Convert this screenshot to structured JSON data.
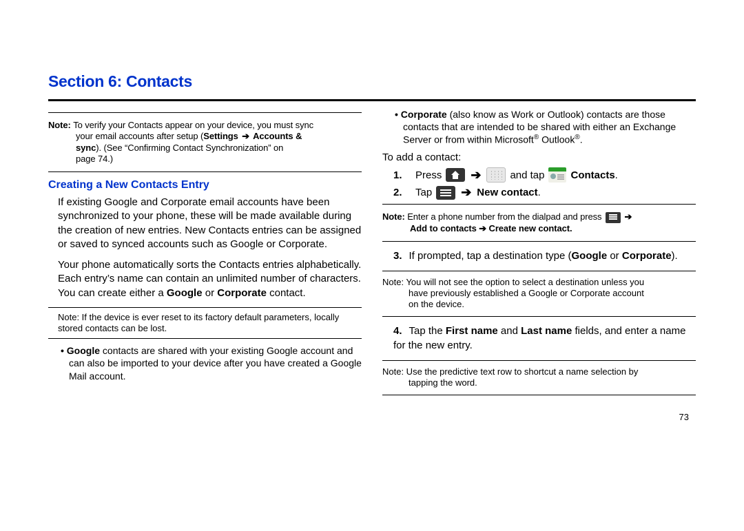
{
  "section_title": "Section 6: Contacts",
  "left": {
    "note1_label": "Note: ",
    "note1_line1": "To verify your Contacts appear on your device, you must sync",
    "note1_line2a": "your email accounts after setup (",
    "note1_bold1": "Settings ",
    "note1_arrow": "➔",
    "note1_bold2": " Accounts &",
    "note1_line3a": "sync",
    "note1_line3b": "). (See “Confirming Contact Synchronization” on",
    "note1_line4": "page 74.)",
    "subhead": "Creating a New Contacts Entry",
    "p1": "If existing Google and Corporate email accounts have been synchronized to your phone, these will be made available during the creation of new entries. New Contacts entries can be assigned or saved to synced accounts such as Google or Corporate.",
    "p2a": "Your phone automatically sorts the Contacts entries alphabetically. Each entry’s name can contain an unlimited number of characters. You can create either a ",
    "p2b_bold": "Google",
    "p2c": " or ",
    "p2d_bold": "Corporate",
    "p2e": " contact.",
    "small_note": "Note: If the device is ever reset to its factory default parameters, locally stored contacts can be lost.",
    "bullet_g_bold": "Google",
    "bullet_g_rest": " contacts are shared with your existing Google account and can also be imported to your device after you have created a Google Mail account."
  },
  "right": {
    "bullet_c_bold": "Corporate",
    "bullet_c_rest_a": " (also know as Work or Outlook) contacts are those contacts that are intended to be shared with either an Exchange Server or from within Microsoft",
    "bullet_c_reg1": "®",
    "bullet_c_rest_b": " Outlook",
    "bullet_c_reg2": "®",
    "bullet_c_rest_c": ".",
    "toadd": "To add a contact:",
    "step1_num": "1.",
    "step1_press": "Press",
    "step1_arrow": "➔",
    "step1_andtap": "and tap",
    "step1_contacts": "Contacts",
    "step1_period": ".",
    "step2_num": "2.",
    "step2_tap": "Tap",
    "step2_arrow": "➔",
    "step2_new": "New contact",
    "step2_period": ".",
    "note2_label": "Note: ",
    "note2_a": "Enter a phone number from the dialpad and press ",
    "note2_arrow": " ➔ ",
    "note2_bold": "Add to contacts ➔ Create new contact.",
    "step3_num": "3.",
    "step3_a": "If prompted, tap a destination type (",
    "step3_google": "Google",
    "step3_or": " or ",
    "step3_corp": "Corporate",
    "step3_b": ").",
    "note3a": "Note: You will not see the option to select a destination unless you",
    "note3b": "have previously established a Google or Corporate account",
    "note3c": "on the device.",
    "step4_num": "4.",
    "step4_a": "Tap the ",
    "step4_first": "First name",
    "step4_and": " and ",
    "step4_last": "Last name",
    "step4_b": " fields, and enter a name for the new entry.",
    "note4a": "Note: Use the predictive text row to shortcut a name selection by",
    "note4b": "tapping the word."
  },
  "pagenum": "73"
}
